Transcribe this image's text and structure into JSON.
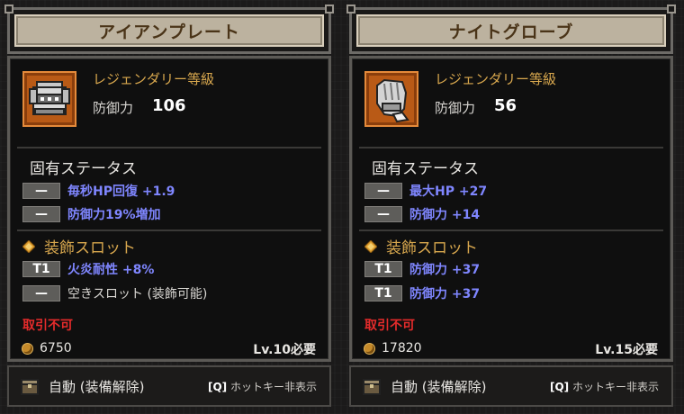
{
  "colors": {
    "grade": "#d9a84e",
    "stat_blue": "#7f86ff",
    "untradeable_red": "#e62b2b",
    "title_bar": "#bcb29f",
    "icon_bg": "#b95a16"
  },
  "panels": [
    {
      "title": "アイアンプレート",
      "icon": "iron-plate-armor-icon",
      "grade": "レジェンダリー等級",
      "defense_label": "防御力",
      "defense_value": "106",
      "unique_status_title": "固有ステータス",
      "unique_stats": [
        {
          "badge": "—",
          "text": "毎秒HP回復 +1.9"
        },
        {
          "badge": "—",
          "text": "防御力19%増加"
        }
      ],
      "slot_title": "装飾スロット",
      "slots": [
        {
          "badge": "T1",
          "text": "火炎耐性 +8%"
        },
        {
          "badge": "—",
          "text": "空きスロット (装飾可能)"
        }
      ],
      "untradeable": "取引不可",
      "price": "6750",
      "level_req": "Lv.10必要",
      "action_label": "自動 (装備解除)",
      "hotkey_key": "[Q]",
      "hotkey_label": "ホットキー非表示"
    },
    {
      "title": "ナイトグローブ",
      "icon": "knight-glove-icon",
      "grade": "レジェンダリー等級",
      "defense_label": "防御力",
      "defense_value": "56",
      "unique_status_title": "固有ステータス",
      "unique_stats": [
        {
          "badge": "—",
          "text": "最大HP +27"
        },
        {
          "badge": "—",
          "text": "防御力 +14"
        }
      ],
      "slot_title": "装飾スロット",
      "slots": [
        {
          "badge": "T1",
          "text": "防御力 +37"
        },
        {
          "badge": "T1",
          "text": "防御力 +37"
        }
      ],
      "untradeable": "取引不可",
      "price": "17820",
      "level_req": "Lv.15必要",
      "action_label": "自動 (装備解除)",
      "hotkey_key": "[Q]",
      "hotkey_label": "ホットキー非表示"
    }
  ]
}
